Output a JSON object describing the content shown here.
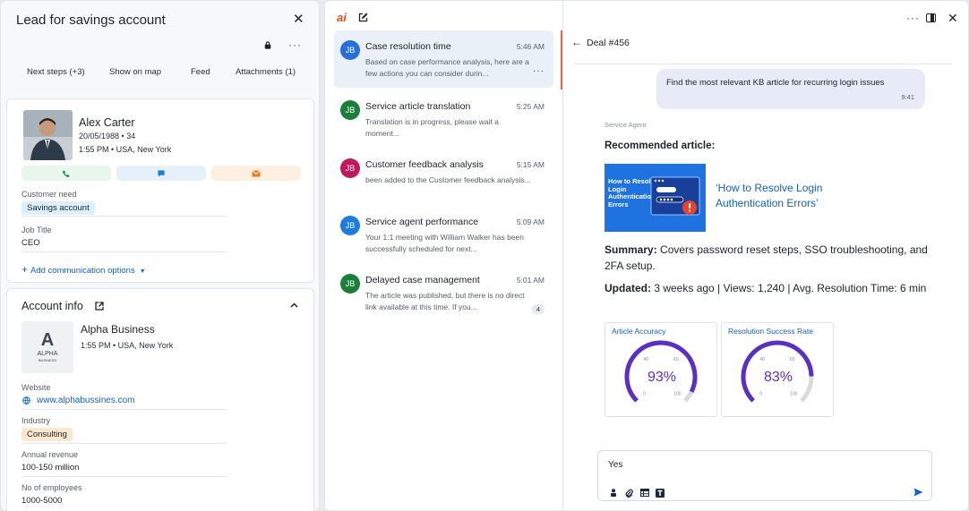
{
  "lead": {
    "title": "Lead for savings account",
    "tabs": [
      "Next steps (+3)",
      "Show on map",
      "Feed",
      "Attachments (1)"
    ],
    "person": {
      "name": "Alex Carter",
      "dob_age": "20/05/1988 • 34",
      "time_location": "1:55 PM • USA, New York"
    },
    "customer_need_label": "Customer need",
    "customer_need_value": "Savings account",
    "job_title_label": "Job Title",
    "job_title_value": "CEO",
    "add_comm": "Add communication options"
  },
  "account": {
    "header": "Account info",
    "company": "Alpha Business",
    "logo_text": "ALPHA",
    "logo_sub": "BUSINESS",
    "time_location": "1:55 PM • USA, New York",
    "website_label": "Website",
    "website_value": "www.alphabussines.com",
    "industry_label": "Industry",
    "industry_value": "Consulting",
    "revenue_label": "Annual revenue",
    "revenue_value": "100-150 million",
    "employees_label": "No of employees",
    "employees_value": "1000-5000"
  },
  "conversations": [
    {
      "initials": "JB",
      "color": "#2a6fd6",
      "title": "Case resolution time",
      "time": "5:46 AM",
      "preview": "Based on case performance analysis, here are a few actions you can consider durin..."
    },
    {
      "initials": "JB",
      "color": "#1b7f3a",
      "title": "Service article translation",
      "time": "5:25 AM",
      "preview": "Translation is in progress, please wait a moment..."
    },
    {
      "initials": "JB",
      "color": "#c2185b",
      "title": "Customer feedback analysis",
      "time": "5:15 AM",
      "preview": "been added to the Customer feedback analysis..."
    },
    {
      "initials": "JB",
      "color": "#1e7be0",
      "title": "Service agent performance",
      "time": "5:09 AM",
      "preview": "Your 1:1 meeting with William Walker has been successfully scheduled for next..."
    },
    {
      "initials": "JB",
      "color": "#1b7f3a",
      "title": "Delayed case management",
      "time": "5:01 AM",
      "preview": "The article was published, but there is no direct link available at this time. If you...",
      "badge": "4"
    }
  ],
  "chat": {
    "logo": "ai",
    "deal": "Deal #456",
    "user_message": "Find the most relevant KB article for recurring login issues",
    "user_time": "9:41",
    "agent_label": "Service Agent",
    "recommended": "Recommended article:",
    "kb_image_text": "How to Resolve Login Authentication Errors",
    "kb_link": "‘How to Resolve Login Authentication Errors’",
    "summary_label": "Summary:",
    "summary_text": " Covers password reset steps, SSO troubleshooting, and 2FA setup.",
    "updated_label": "Updated:",
    "updated_text": " 3 weeks ago | Views: 1,240 | Avg. Resolution Time: 6 min",
    "gauges": [
      {
        "title": "Article Accuracy",
        "value": "93%",
        "fraction": 0.93,
        "ticks": [
          "0",
          "40",
          "60",
          "100"
        ]
      },
      {
        "title": "Resolution Success Rate",
        "value": "83%",
        "fraction": 0.83,
        "ticks": [
          "0",
          "40",
          "60",
          "100"
        ]
      }
    ],
    "input_value": "Yes",
    "colors": {
      "gauge": "#5a2fc2",
      "accent": "#e84b1c"
    }
  }
}
